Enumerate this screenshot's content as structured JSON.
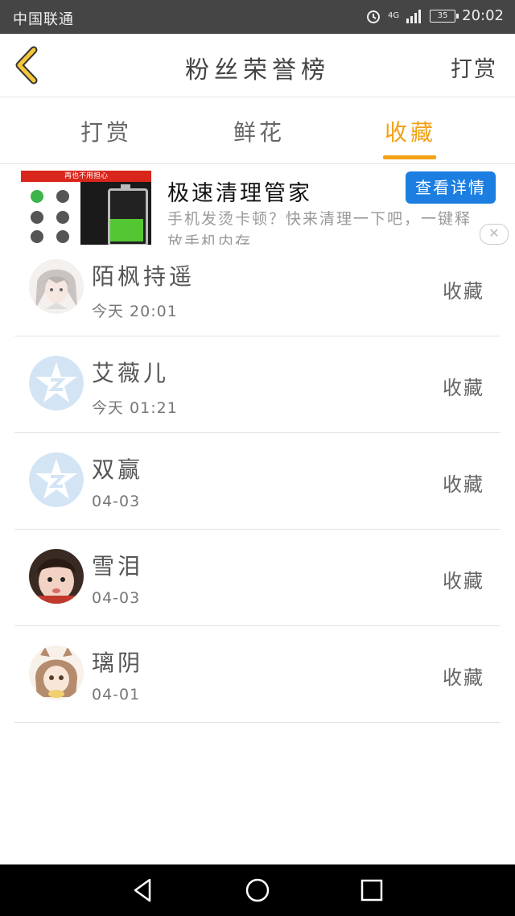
{
  "status_bar": {
    "carrier": "中国联通",
    "network": "4G",
    "battery": "35",
    "time": "20:02"
  },
  "header": {
    "title": "粉丝荣誉榜",
    "right_link": "打赏",
    "back_icon": "chevron-left-icon"
  },
  "tabs": [
    {
      "label": "打赏",
      "active": false
    },
    {
      "label": "鲜花",
      "active": false
    },
    {
      "label": "收藏",
      "active": true
    }
  ],
  "ad": {
    "banner_text": "再也不用担心",
    "title": "极速清理管家",
    "description": "手机发烫卡顿？快来清理一下吧，一键释放手机内存",
    "button": "查看详情",
    "close": "✕"
  },
  "fans": [
    {
      "name": "陌枫持遥",
      "time": "今天 20:01",
      "action": "收藏",
      "avatar": "anime-portrait-avatar"
    },
    {
      "name": "艾薇儿",
      "time": "今天 01:21",
      "action": "收藏",
      "avatar": "default-star-avatar"
    },
    {
      "name": "双赢",
      "time": "04-03",
      "action": "收藏",
      "avatar": "default-star-avatar"
    },
    {
      "name": "雪泪",
      "time": "04-03",
      "action": "收藏",
      "avatar": "child-photo-avatar"
    },
    {
      "name": "璃阴",
      "time": "04-01",
      "action": "收藏",
      "avatar": "anime-hooded-avatar"
    }
  ],
  "colors": {
    "accent": "#f2a114",
    "ad_button": "#1b7ee0",
    "status_bar": "#454545"
  }
}
